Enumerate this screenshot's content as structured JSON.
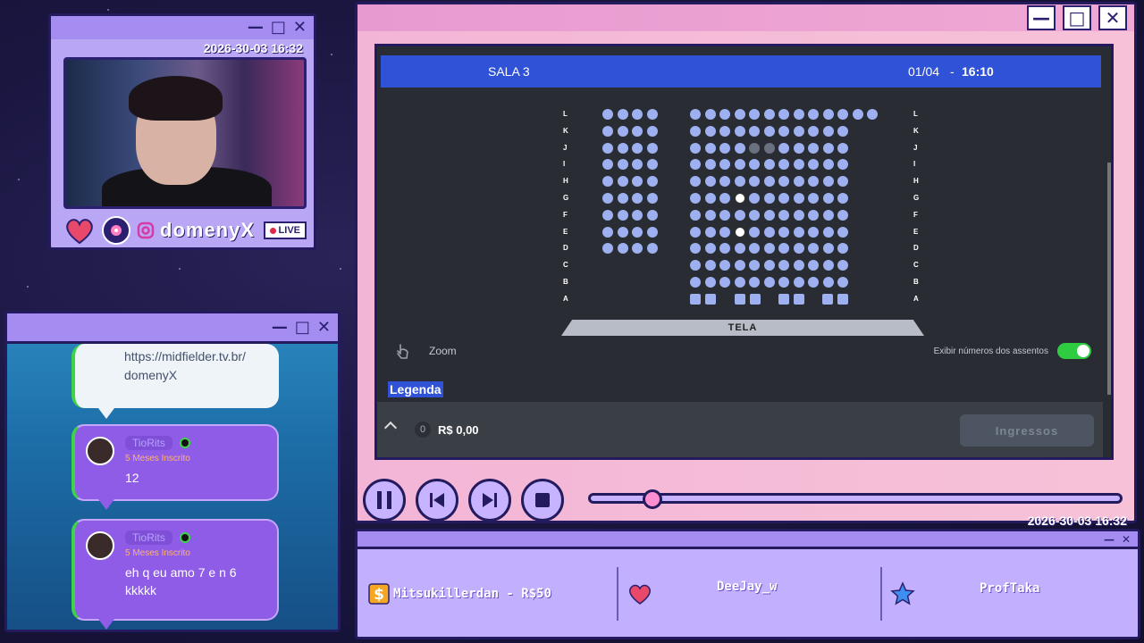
{
  "cam": {
    "timestamp": "2026-30-03 16:32",
    "streamer": "domenyX",
    "live_label": "LIVE"
  },
  "chat": {
    "messages": [
      {
        "text": "https://midfielder.tv.br/ domenyX"
      },
      {
        "user": "TioRits",
        "subs": "5 Meses Inscrito",
        "text": "12"
      },
      {
        "user": "TioRits",
        "subs": "5 Meses Inscrito",
        "text": "eh q eu amo 7 e n 6 kkkkk"
      }
    ]
  },
  "cinema": {
    "sala": "SALA 3",
    "date": "01/04",
    "sep": "-",
    "time": "16:10",
    "screen_label": "TELA",
    "zoom_label": "Zoom",
    "toggle_label": "Exibir números dos assentos",
    "toggle_on": true,
    "legend_label": "Legenda",
    "cart_count": "0",
    "price": "R$ 0,00",
    "tickets_button": "Ingressos",
    "rows": [
      "L",
      "K",
      "J",
      "I",
      "H",
      "G",
      "F",
      "E",
      "D",
      "C",
      "B",
      "A"
    ]
  },
  "player": {
    "progress": 0.12,
    "timestamp": "2026-30-03 16:32"
  },
  "alerts": {
    "donation": "Mitsukillerdan - R$50",
    "follower": "DeeJay_w",
    "subscriber": "ProfTaka"
  },
  "colors": {
    "accent_blue": "#2f52d6",
    "toggle_green": "#2ecc40",
    "window_purple": "#a48cf0"
  }
}
